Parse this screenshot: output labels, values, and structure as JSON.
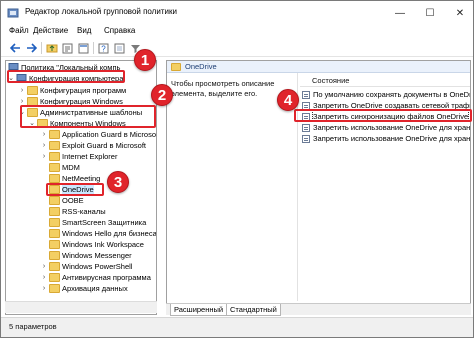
{
  "window": {
    "title": "Редактор локальной групповой политики",
    "controls": {
      "minimize": "—",
      "maximize": "☐",
      "close": "✕"
    }
  },
  "menu": [
    "Файл",
    "Действие",
    "Вид",
    "Справка"
  ],
  "toolbar": [
    "back-arrow-icon",
    "forward-arrow-icon",
    "folder-up-icon",
    "properties-icon",
    "export-icon",
    "help-icon",
    "view-icon",
    "filter-icon"
  ],
  "tree": {
    "root": "Политика \"Локальный компь",
    "items": [
      {
        "label": "Конфигурация компьютера",
        "level": 1,
        "expanded": true
      },
      {
        "label": "Конфигурация программ",
        "level": 2
      },
      {
        "label": "Конфигурация Windows",
        "level": 2
      },
      {
        "label": "Административные шаблоны",
        "level": 2,
        "expanded": true
      },
      {
        "label": "Компоненты Windows",
        "level": 3,
        "expanded": true
      },
      {
        "label": "Application Guard в Microsoft",
        "level": 4
      },
      {
        "label": "Exploit Guard в Microsoft",
        "level": 4
      },
      {
        "label": "Internet Explorer",
        "level": 4
      },
      {
        "label": "MDM",
        "level": 4
      },
      {
        "label": "NetMeeting",
        "level": 4
      },
      {
        "label": "OneDrive",
        "level": 4,
        "selected": true
      },
      {
        "label": "OOBE",
        "level": 4
      },
      {
        "label": "RSS-каналы",
        "level": 4
      },
      {
        "label": "SmartScreen Защитника",
        "level": 4
      },
      {
        "label": "Windows Hello для бизнеса",
        "level": 4
      },
      {
        "label": "Windows Ink Workspace",
        "level": 4
      },
      {
        "label": "Windows Messenger",
        "level": 4
      },
      {
        "label": "Windows PowerShell",
        "level": 4
      },
      {
        "label": "Антивирусная программа",
        "level": 4
      },
      {
        "label": "Архивация данных",
        "level": 4
      }
    ]
  },
  "details": {
    "header": "OneDrive",
    "description": "Чтобы просмотреть описание элемента, выделите его.",
    "column_header": "Состояние",
    "policies": [
      "По умолчанию сохранять документы в OneDrive",
      "Запретить OneDrive создавать сетевой трафик",
      "Запретить синхронизацию файлов OneDrive",
      "Запретить использование OneDrive для хранения",
      "Запретить использование OneDrive для хранения"
    ]
  },
  "tabs": [
    "Расширенный",
    "Стандартный"
  ],
  "status": "5 параметров",
  "callouts": [
    "1",
    "2",
    "3",
    "4"
  ],
  "colors": {
    "callout": "#e0242b",
    "selection": "#cce8ff",
    "folder": "#f3cf63"
  }
}
